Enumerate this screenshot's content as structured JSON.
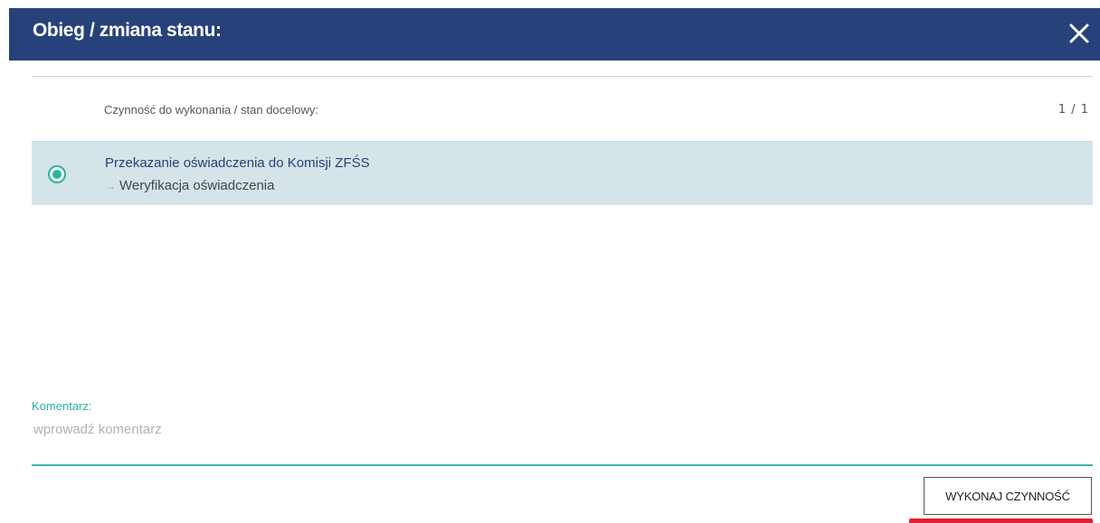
{
  "dialog": {
    "title": "Obieg / zmiana stanu:",
    "close_icon": "close-icon"
  },
  "list": {
    "header": "Czynność do wykonania / stan docelowy:",
    "count": "1 / 1",
    "options": [
      {
        "title": "Przekazanie oświadczenia do Komisji ZFŚS",
        "arrow": "→",
        "target_state": "Weryfikacja oświadczenia",
        "selected": true
      }
    ]
  },
  "comment": {
    "label": "Komentarz:",
    "placeholder": "wprowadź komentarz",
    "value": ""
  },
  "actions": {
    "execute_label": "WYKONAJ CZYNNOŚĆ"
  },
  "colors": {
    "header_bg": "#27417a",
    "accent_teal": "#27b59b",
    "selected_row_bg": "#d5e4e9",
    "highlight_red": "#e0202e"
  }
}
